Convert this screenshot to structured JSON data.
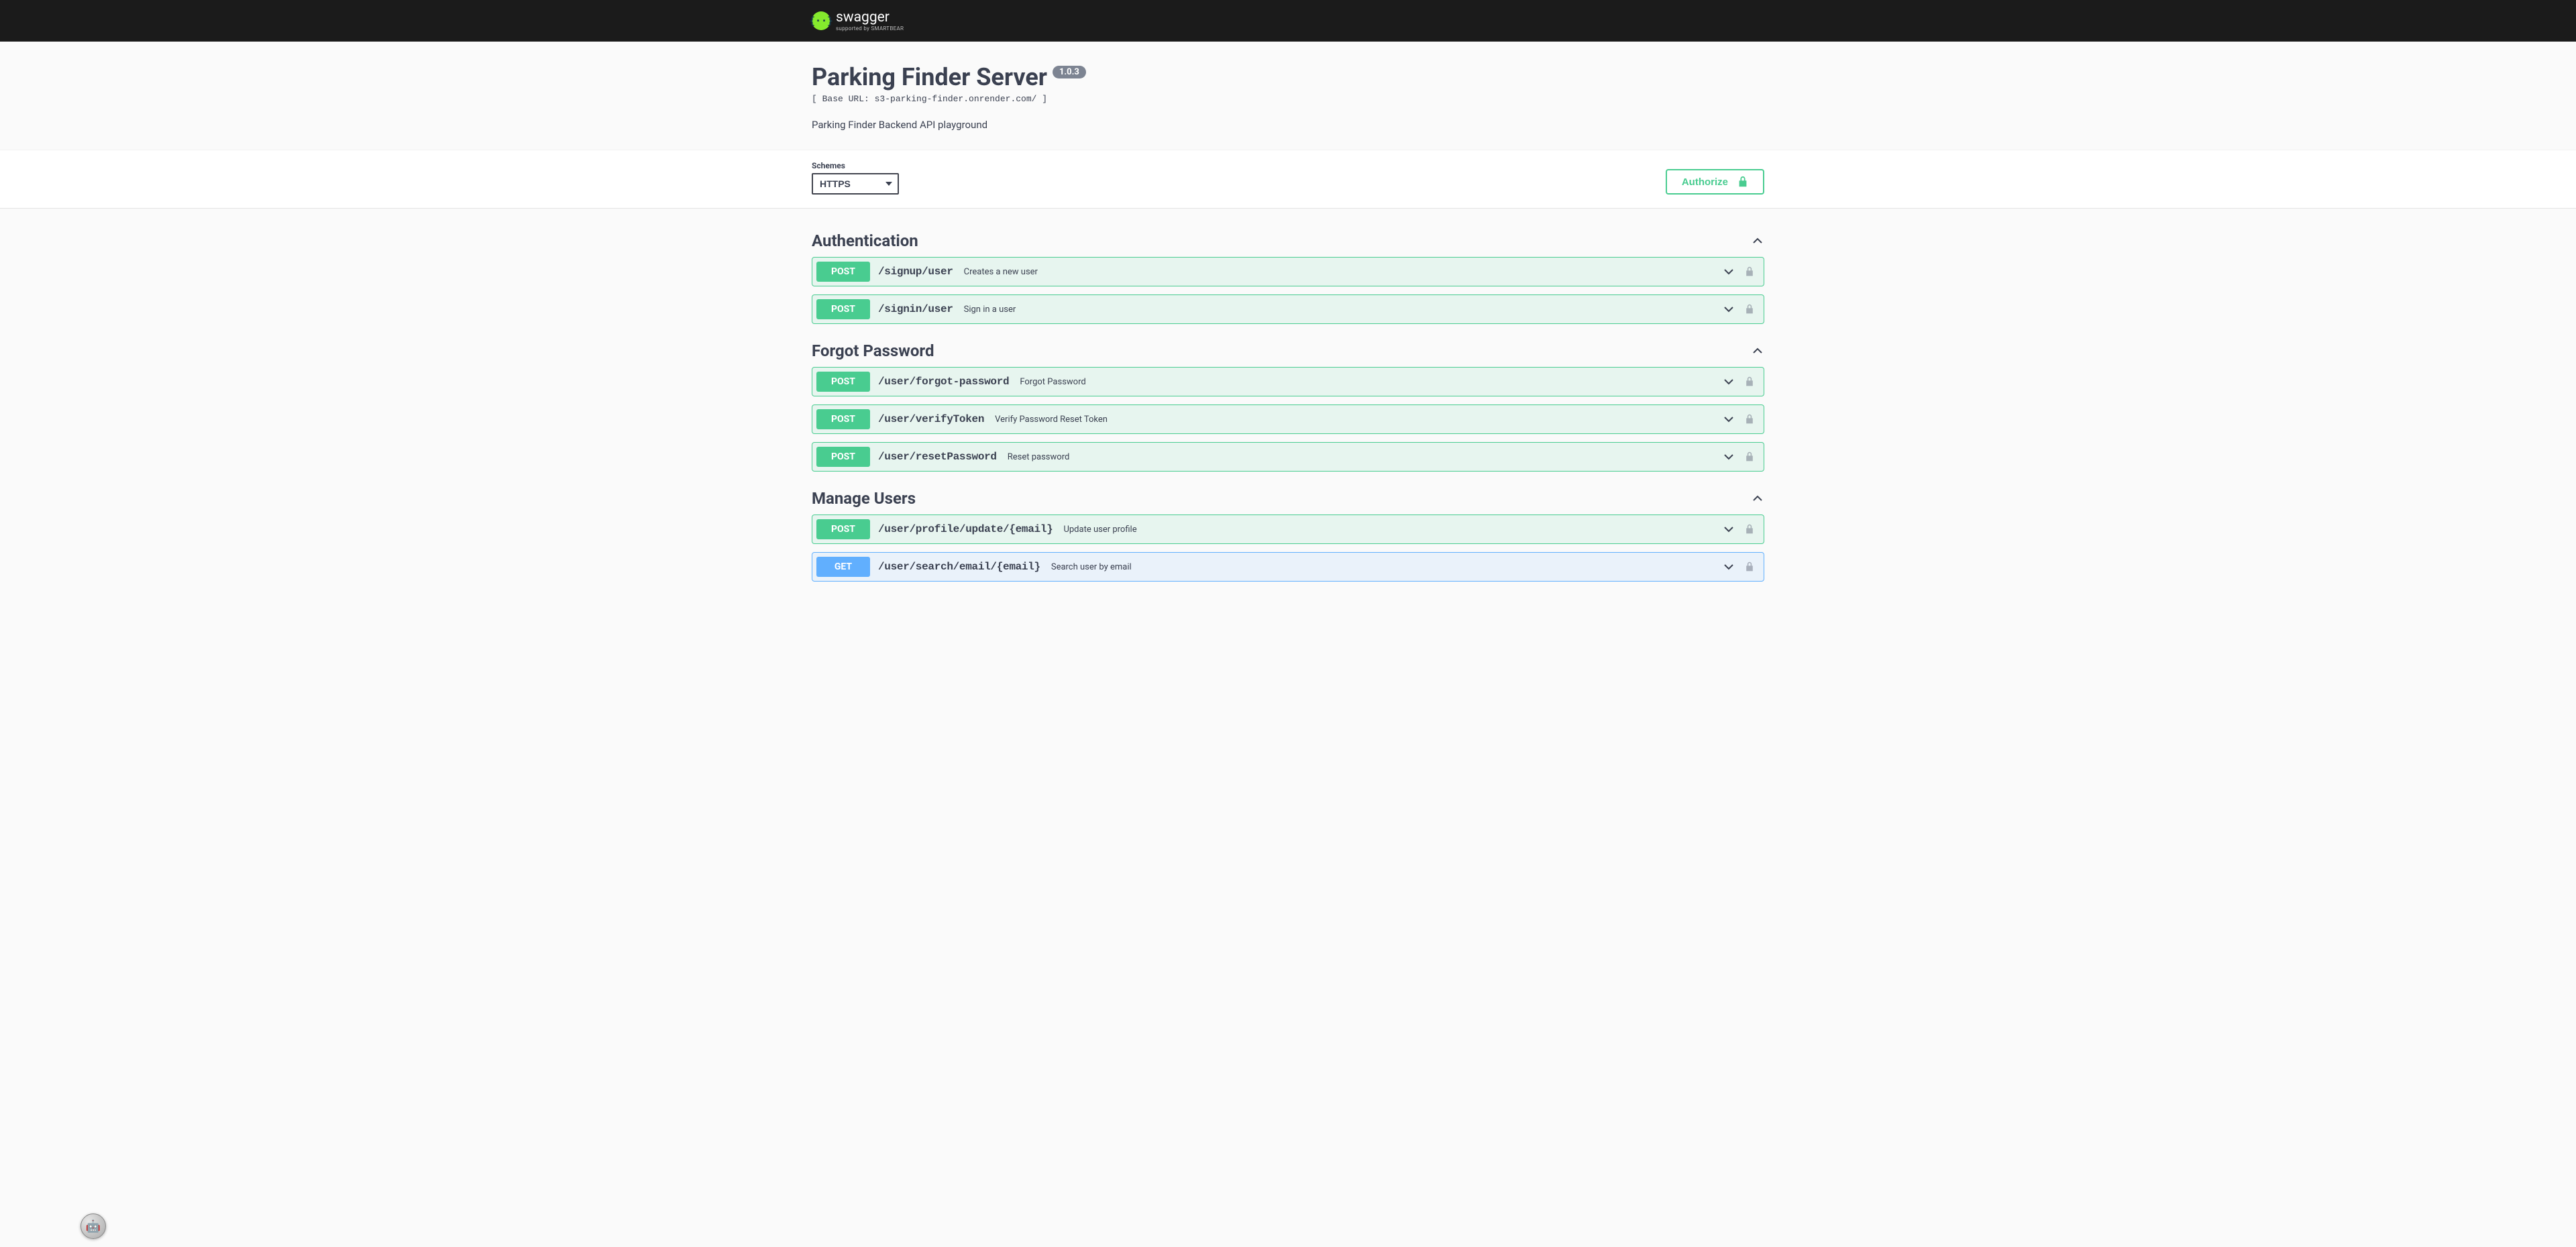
{
  "topbar": {
    "logo_text": "swagger",
    "logo_sub": "supported by SMARTBEAR"
  },
  "info": {
    "title": "Parking Finder Server",
    "version": "1.0.3",
    "base_url_line": "[ Base URL: s3-parking-finder.onrender.com/ ]",
    "description": "Parking Finder Backend API playground"
  },
  "schemes": {
    "label": "Schemes",
    "selected": "HTTPS"
  },
  "authorize_label": "Authorize",
  "tags": [
    {
      "name": "Authentication",
      "ops": [
        {
          "method": "POST",
          "path": "/signup/user",
          "summary": "Creates a new user"
        },
        {
          "method": "POST",
          "path": "/signin/user",
          "summary": "Sign in a user"
        }
      ]
    },
    {
      "name": "Forgot Password",
      "ops": [
        {
          "method": "POST",
          "path": "/user/forgot-password",
          "summary": "Forgot Password"
        },
        {
          "method": "POST",
          "path": "/user/verifyToken",
          "summary": "Verify Password Reset Token"
        },
        {
          "method": "POST",
          "path": "/user/resetPassword",
          "summary": "Reset password"
        }
      ]
    },
    {
      "name": "Manage Users",
      "ops": [
        {
          "method": "POST",
          "path": "/user/profile/update/{email}",
          "summary": "Update user profile"
        },
        {
          "method": "GET",
          "path": "/user/search/email/{email}",
          "summary": "Search user by email"
        }
      ]
    }
  ]
}
